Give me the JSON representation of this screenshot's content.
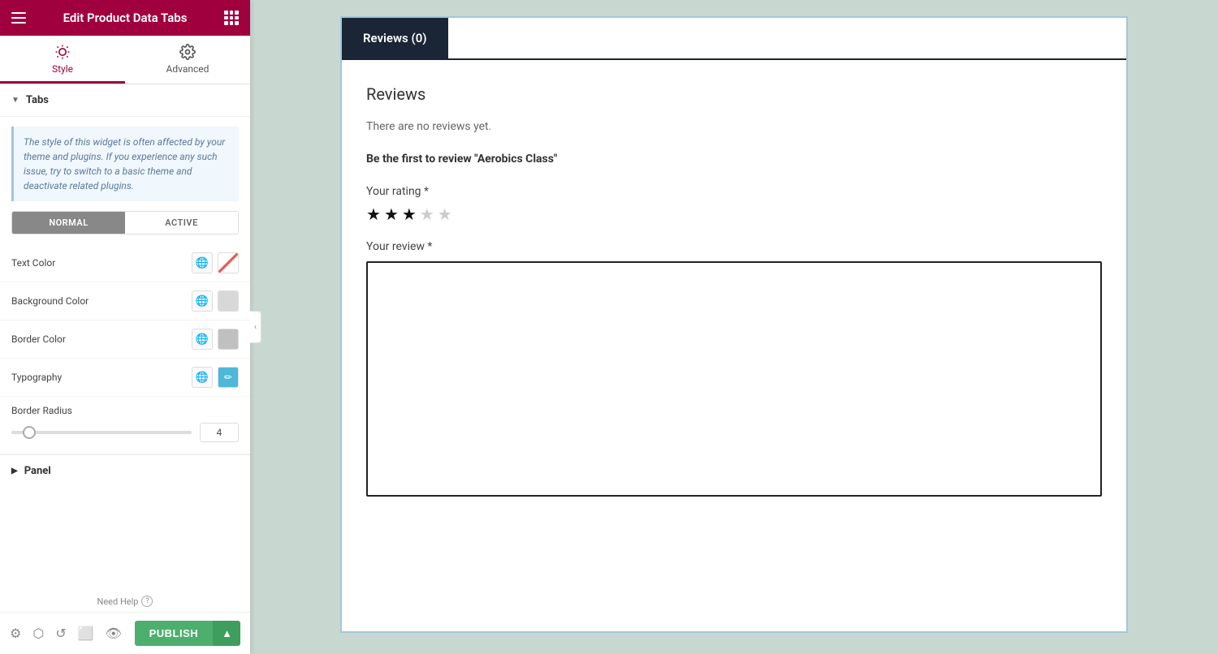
{
  "header": {
    "title": "Edit Product Data Tabs",
    "hamburger_label": "menu",
    "grid_label": "apps"
  },
  "panel_tabs": [
    {
      "id": "style",
      "label": "Style",
      "active": true
    },
    {
      "id": "advanced",
      "label": "Advanced",
      "active": false
    }
  ],
  "tabs_section": {
    "label": "Tabs",
    "collapsed": false,
    "info_text": "The style of this widget is often affected by your theme and plugins. If you experience any such issue, try to switch to a basic theme and deactivate related plugins.",
    "toggle": {
      "normal": "NORMAL",
      "active": "ACTIVE",
      "selected": "normal"
    },
    "properties": {
      "text_color": {
        "label": "Text Color"
      },
      "background_color": {
        "label": "Background Color"
      },
      "border_color": {
        "label": "Border Color"
      },
      "typography": {
        "label": "Typography"
      },
      "border_radius": {
        "label": "Border Radius",
        "value": "4",
        "slider_percent": 10
      }
    }
  },
  "panel_section": {
    "label": "Panel"
  },
  "need_help": "Need Help",
  "publish": {
    "label": "PUBLISH"
  },
  "review_tab": {
    "tab_label": "Reviews (0)",
    "section_title": "Reviews",
    "no_reviews_text": "There are no reviews yet.",
    "be_first_text": "Be the first to review \"Aerobics Class\"",
    "your_rating_label": "Your rating *",
    "stars": [
      true,
      true,
      true,
      false,
      false
    ],
    "your_review_label": "Your review *"
  }
}
